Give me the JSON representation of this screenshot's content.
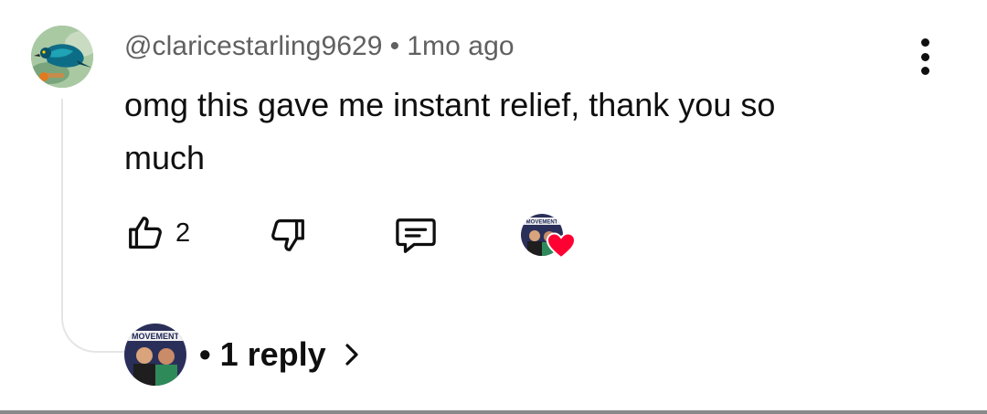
{
  "comment": {
    "author": "@claricestarling9629",
    "separator": "•",
    "timestamp": "1mo ago",
    "text": "omg this gave me instant relief, thank you so much",
    "like_count": "2",
    "avatar_icon": "bird-avatar-icon",
    "creator_heart": {
      "badge_text": "MOVEMENT",
      "heart_color": "#ff0033"
    }
  },
  "replies": {
    "separator": "•",
    "label": "1 reply",
    "avatar_badge_text": "MOVEMENT"
  },
  "icons": {
    "like": "thumbs-up-icon",
    "dislike": "thumbs-down-icon",
    "reply": "comment-icon",
    "more": "more-vertical-icon",
    "chevron": "chevron-right-icon"
  },
  "colors": {
    "text_primary": "#0f0f0f",
    "text_secondary": "#606060",
    "heart": "#ff0033"
  }
}
